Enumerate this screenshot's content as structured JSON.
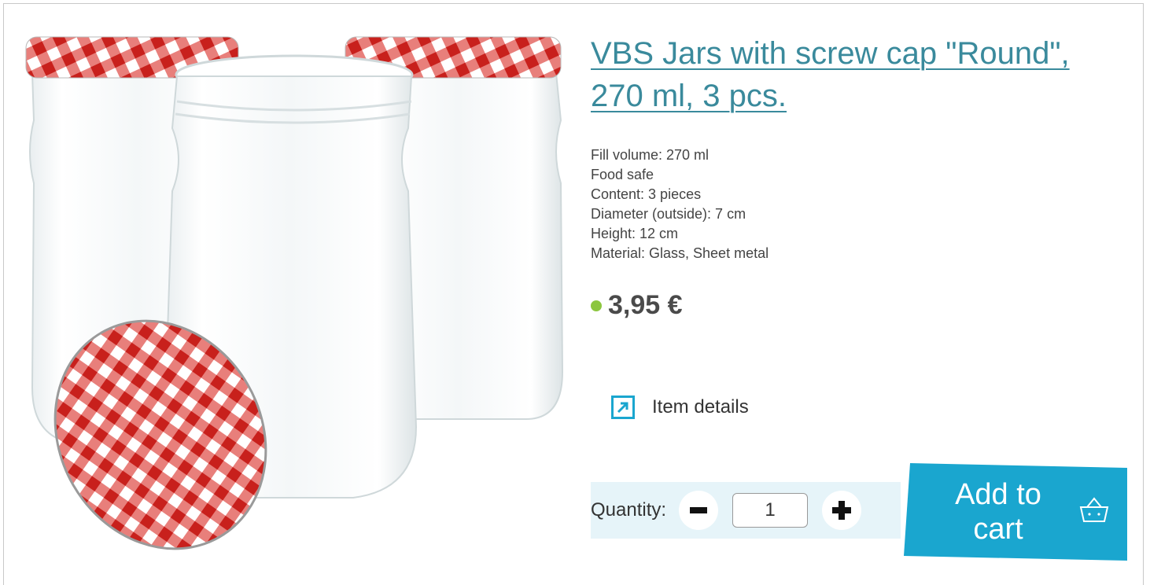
{
  "product": {
    "title": "VBS Jars with screw cap \"Round\", 270 ml, 3 pcs.",
    "image_alt": "Three glass jars with red-white checkered screw caps",
    "specs": [
      "Fill volume: 270 ml",
      "Food safe",
      "Content: 3 pieces",
      "Diameter (outside): 7 cm",
      "Height: 12 cm",
      "Material: Glass, Sheet metal"
    ],
    "price": "3,95 €",
    "availability_color": "#8cc63f"
  },
  "details_link": {
    "label": "Item details",
    "icon": "external-link-icon"
  },
  "quantity": {
    "label": "Quantity:",
    "value": "1",
    "minus_icon": "minus-icon",
    "plus_icon": "plus-icon"
  },
  "cart_button": {
    "label": "Add to cart",
    "icon": "basket-icon"
  },
  "colors": {
    "title": "#3a8a9c",
    "accent": "#1aa6cf",
    "qty_panel": "#e6f4f9",
    "lid_red": "#d9322e"
  }
}
